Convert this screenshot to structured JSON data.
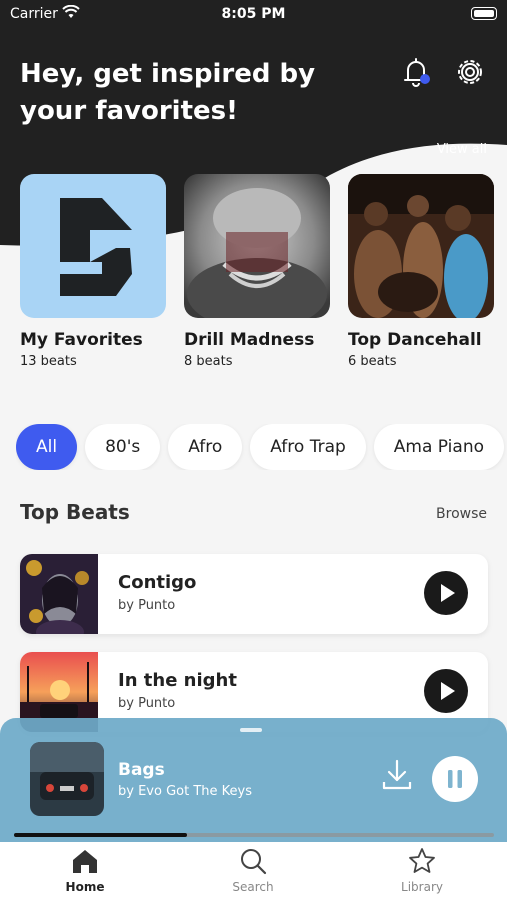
{
  "status_bar": {
    "carrier": "Carrier",
    "time": "8:05 PM"
  },
  "header": {
    "title": "Hey, get inspired by your favorites!",
    "view_all": "View all",
    "icons": [
      "bell-icon",
      "gear-icon"
    ]
  },
  "playlists": [
    {
      "title": "My Favorites",
      "count": "13 beats"
    },
    {
      "title": "Drill Madness",
      "count": "8 beats"
    },
    {
      "title": "Top Dancehall",
      "count": "6 beats"
    }
  ],
  "genres": [
    "All",
    "80's",
    "Afro",
    "Afro Trap",
    "Ama Piano"
  ],
  "active_genre": "All",
  "top_beats": {
    "title": "Top Beats",
    "browse": "Browse",
    "items": [
      {
        "name": "Contigo",
        "artist": "by Punto"
      },
      {
        "name": "In the night",
        "artist": "by Punto"
      }
    ]
  },
  "now_playing": {
    "title": "Bags",
    "artist": "by Evo Got The Keys",
    "progress": 0.36
  },
  "tabs": [
    {
      "label": "Home",
      "icon": "home-icon",
      "active": true
    },
    {
      "label": "Search",
      "icon": "search-icon",
      "active": false
    },
    {
      "label": "Library",
      "icon": "star-icon",
      "active": false
    }
  ],
  "colors": {
    "accent": "#3f5bef",
    "hero": "#212121",
    "player": "#6eaac8",
    "favorites_tile": "#a9d4f5"
  }
}
